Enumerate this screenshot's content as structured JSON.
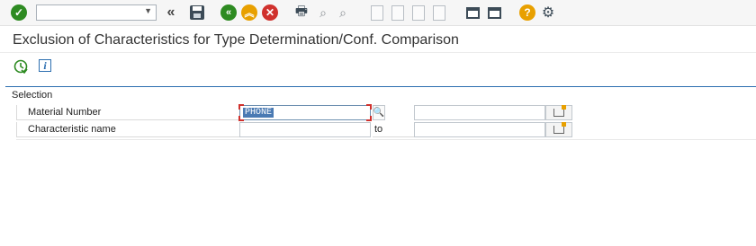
{
  "toolbar": {
    "command_field_value": "",
    "icons": [
      "ok-icon",
      "double-left-icon",
      "save-icon",
      "back-icon",
      "exit-icon",
      "cancel-icon",
      "print-icon",
      "find-icon",
      "find-next-icon",
      "first-page-icon",
      "previous-page-icon",
      "next-page-icon",
      "last-page-icon",
      "new-session-icon",
      "shortcut-icon",
      "help-icon",
      "settings-icon"
    ]
  },
  "header": {
    "title": "Exclusion of Characteristics for Type Determination/Conf. Comparison"
  },
  "app_toolbar": {
    "icons": [
      "execute-icon",
      "info-icon"
    ],
    "info_glyph": "i"
  },
  "selection": {
    "title": "Selection",
    "rows": [
      {
        "label": "Material Number",
        "low": "PHONE",
        "to_label": "",
        "high": ""
      },
      {
        "label": "Characteristic name",
        "low": "",
        "to_label": "to",
        "high": ""
      }
    ]
  },
  "colors": {
    "accent": "#2d6fb0",
    "ok": "#2e8b22",
    "cancel": "#d0312d",
    "warn": "#e8a000"
  }
}
